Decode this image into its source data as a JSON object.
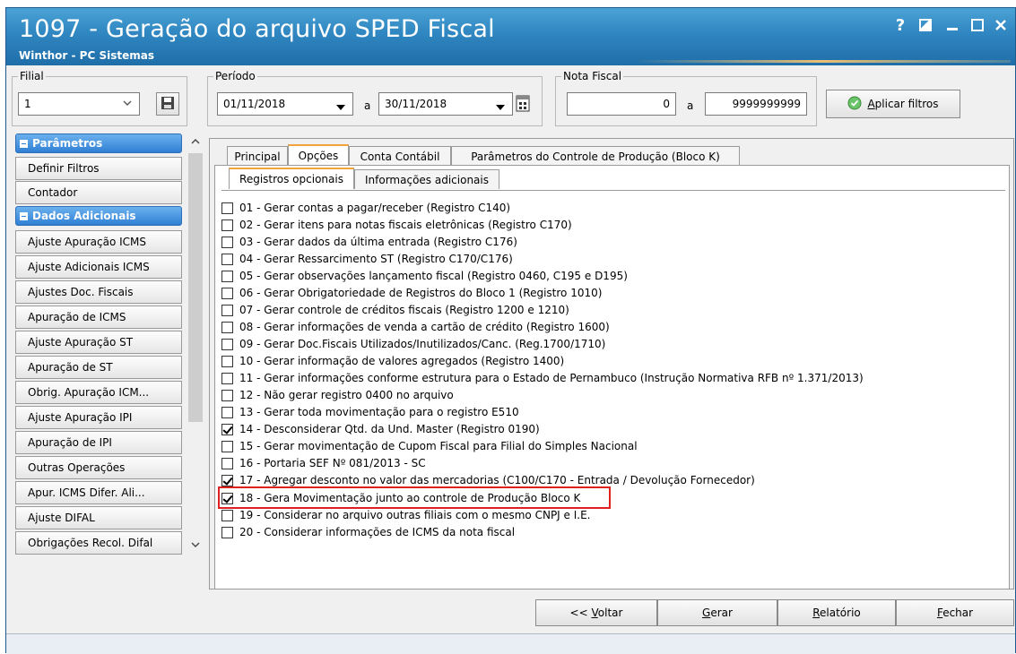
{
  "window": {
    "title": "1097 - Geração do arquivo SPED Fiscal",
    "subtitle": "Winthor - PC Sistemas",
    "controls": [
      "help-icon",
      "restore-icon",
      "minimize-icon",
      "maximize-icon",
      "close-icon"
    ]
  },
  "filial": {
    "label": "Filial",
    "value": "1"
  },
  "periodo": {
    "label": "Período",
    "start": "01/11/2018",
    "sep": "a",
    "end": "30/11/2018"
  },
  "nota_fiscal": {
    "label": "Nota Fiscal",
    "start": "0",
    "sep": "a",
    "end": "9999999999"
  },
  "apply_filters": {
    "label_pre": "",
    "label_u": "A",
    "label_post": "plicar filtros"
  },
  "sidebar": {
    "parametros_header": "Parâmetros",
    "parametros_items": [
      "Definir Filtros",
      "Contador"
    ],
    "dados_header": "Dados Adicionais",
    "dados_items": [
      "Ajuste Apuração ICMS",
      "Ajuste Adicionais ICMS",
      "Ajustes Doc. Fiscais",
      "Apuração de ICMS",
      "Ajuste Apuração ST",
      "Apuração de ST",
      "Obrig. Apuração ICM...",
      "Ajuste Apuração IPI",
      "Apuração de IPI",
      "Outras Operações",
      "Apur. ICMS Difer. Ali...",
      "Ajuste DIFAL",
      "Obrigações Recol. Difal"
    ]
  },
  "tabs": [
    "Principal",
    "Opções",
    "Conta Contábil",
    "Parâmetros do Controle de Produção (Bloco K)"
  ],
  "subtabs": [
    "Registros opcionais",
    "Informações adicionais"
  ],
  "options": [
    {
      "label": "01 - Gerar contas a pagar/receber (Registro C140)",
      "checked": false
    },
    {
      "label": "02 - Gerar itens para notas fiscais eletrônicas (Registro C170)",
      "checked": false
    },
    {
      "label": "03 - Gerar dados da última entrada (Registro C176)",
      "checked": false
    },
    {
      "label": "04 - Gerar Ressarcimento ST (Registro C170/C176)",
      "checked": false
    },
    {
      "label": "05 - Gerar observações lançamento fiscal (Registro 0460, C195 e D195)",
      "checked": false
    },
    {
      "label": "06 - Gerar Obrigatoriedade de Registros do Bloco 1 (Registro  1010)",
      "checked": false
    },
    {
      "label": "07 - Gerar controle de créditos fiscais (Registro 1200 e 1210)",
      "checked": false
    },
    {
      "label": "08 - Gerar informações de venda a cartão de crédito (Registro 1600)",
      "checked": false
    },
    {
      "label": "09 - Gerar Doc.Fiscais Utilizados/Inutilizados/Canc. (Reg.1700/1710)",
      "checked": false
    },
    {
      "label": "10 - Gerar informação de valores agregados (Registro 1400)",
      "checked": false
    },
    {
      "label": "11 - Gerar informações conforme estrutura para o Estado de Pernambuco (Instrução Normativa RFB nº 1.371/2013)",
      "checked": false
    },
    {
      "label": "12 - Não gerar registro 0400 no arquivo",
      "checked": false
    },
    {
      "label": "13 - Gerar toda movimentação para o registro E510",
      "checked": false
    },
    {
      "label": "14 - Desconsiderar Qtd. da Und. Master (Registro 0190)",
      "checked": true
    },
    {
      "label": "15 - Gerar movimentação de Cupom Fiscal para Filial do Simples Nacional",
      "checked": false
    },
    {
      "label": "16 - Portaria SEF Nº 081/2013 - SC",
      "checked": false
    },
    {
      "label": "17 - Agregar desconto no valor das mercadorias (C100/C170 - Entrada / Devolução Fornecedor)",
      "checked": true
    },
    {
      "label": "18 - Gera Movimentação junto ao controle de Produção Bloco K",
      "checked": true
    },
    {
      "label": "19 - Considerar no arquivo outras filiais com o mesmo CNPJ e I.E.",
      "checked": false
    },
    {
      "label": "20 - Considerar informações de ICMS da nota fiscal",
      "checked": false
    }
  ],
  "buttons": {
    "voltar_pre": "<< ",
    "voltar_u": "V",
    "voltar_post": "oltar",
    "gerar_u": "G",
    "gerar_post": "erar",
    "relatorio_u": "R",
    "relatorio_post": "elatório",
    "fechar_u": "F",
    "fechar_post": "echar"
  },
  "colors": {
    "title_bar": "#2f86c0",
    "accent_tab": "#f2a33a",
    "highlight": "#e02020",
    "side_header": "#2f7fd4"
  }
}
